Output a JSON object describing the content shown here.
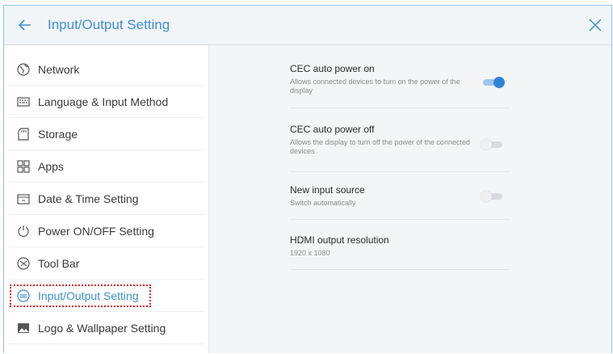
{
  "header": {
    "title": "Input/Output Setting"
  },
  "sidebar": {
    "items": [
      {
        "label": "Network",
        "icon": "globe-icon"
      },
      {
        "label": "Language & Input Method",
        "icon": "keyboard-icon"
      },
      {
        "label": "Storage",
        "icon": "sd-card-icon"
      },
      {
        "label": "Apps",
        "icon": "apps-grid-icon"
      },
      {
        "label": "Date & Time Setting",
        "icon": "calendar-icon"
      },
      {
        "label": "Power ON/OFF Setting",
        "icon": "power-icon"
      },
      {
        "label": "Tool Bar",
        "icon": "toolbar-icon"
      },
      {
        "label": "Input/Output Setting",
        "icon": "input-output-icon",
        "active": true
      },
      {
        "label": "Logo & Wallpaper Setting",
        "icon": "image-icon"
      }
    ]
  },
  "settings": [
    {
      "title": "CEC auto power on",
      "desc": "Allows connected devices to turn on the power of the display",
      "toggle": true
    },
    {
      "title": "CEC auto power off",
      "desc": "Allows the display to turn off the power of the connected devices",
      "toggle": false
    },
    {
      "title": "New input source",
      "desc": "Switch automatically",
      "toggle": false
    },
    {
      "title": "HDMI output resolution",
      "desc": "1920 x 1080"
    }
  ],
  "colors": {
    "accent": "#3d8fd6",
    "highlight": "#d9252b"
  }
}
